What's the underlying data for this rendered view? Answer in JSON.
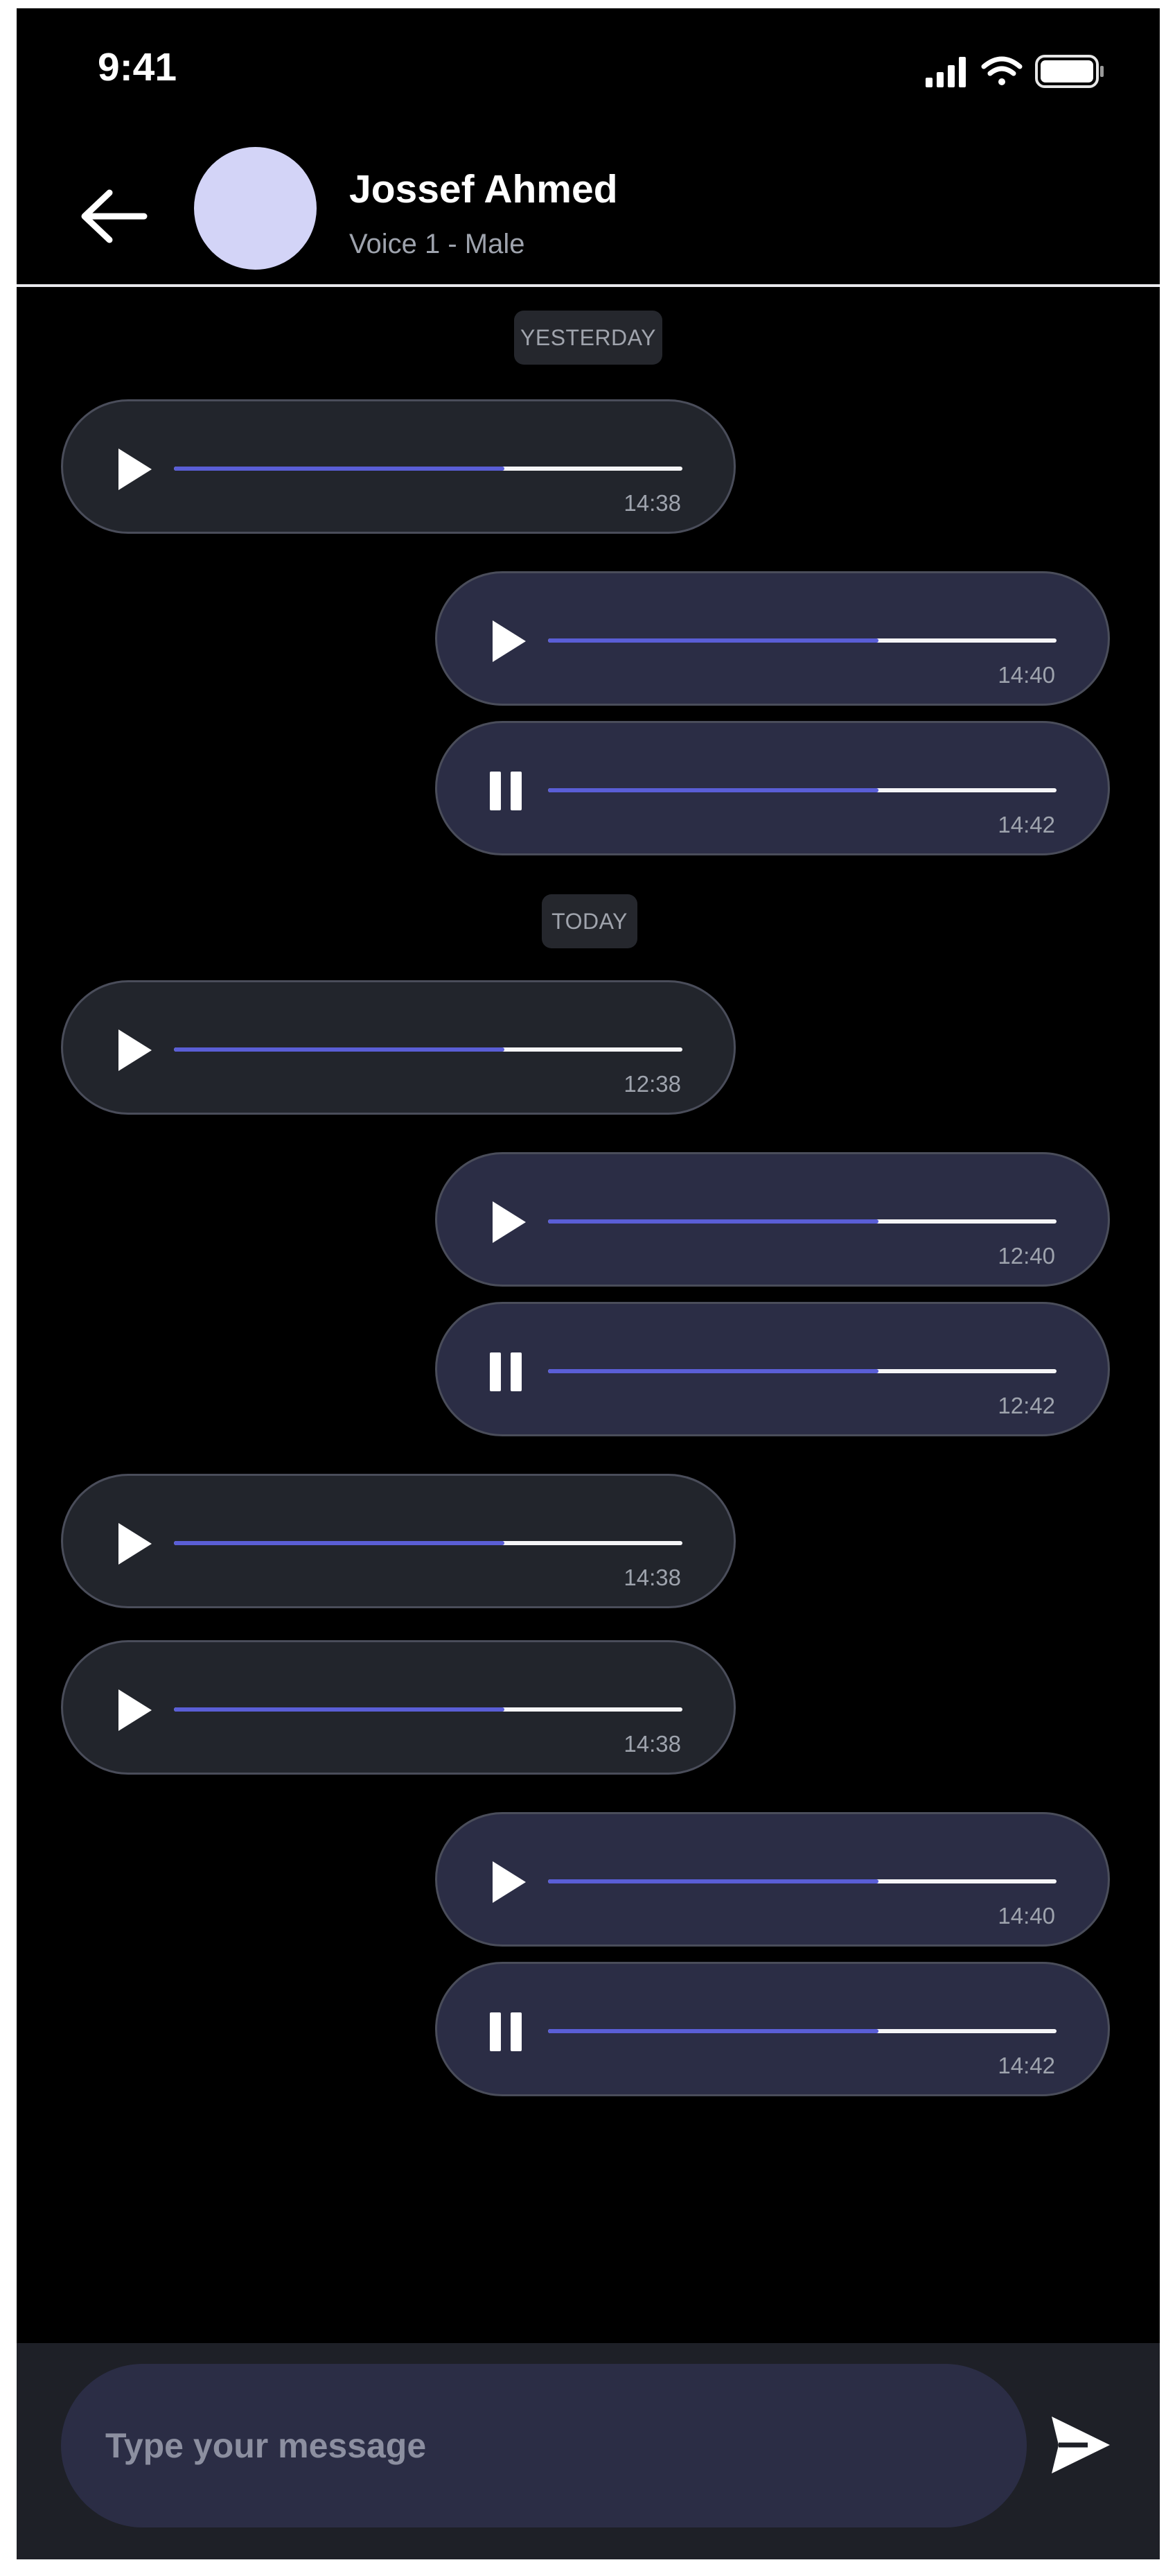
{
  "status_bar": {
    "time": "9:41"
  },
  "header": {
    "name": "Jossef Ahmed",
    "subtitle": "Voice 1 - Male"
  },
  "day_labels": [
    "YESTERDAY",
    "TODAY"
  ],
  "messages": [
    {
      "direction": "in",
      "state": "paused",
      "progress": 0.65,
      "time": "14:38"
    },
    {
      "direction": "out",
      "state": "paused",
      "progress": 0.65,
      "time": "14:40"
    },
    {
      "direction": "out",
      "state": "playing",
      "progress": 0.65,
      "time": "14:42"
    },
    {
      "direction": "in",
      "state": "paused",
      "progress": 0.65,
      "time": "12:38"
    },
    {
      "direction": "out",
      "state": "paused",
      "progress": 0.65,
      "time": "12:40"
    },
    {
      "direction": "out",
      "state": "playing",
      "progress": 0.65,
      "time": "12:42"
    },
    {
      "direction": "in",
      "state": "paused",
      "progress": 0.65,
      "time": "14:38"
    },
    {
      "direction": "in",
      "state": "paused",
      "progress": 0.65,
      "time": "14:38"
    },
    {
      "direction": "out",
      "state": "paused",
      "progress": 0.65,
      "time": "14:40"
    },
    {
      "direction": "out",
      "state": "playing",
      "progress": 0.65,
      "time": "14:42"
    }
  ],
  "composer": {
    "placeholder": "Type your message"
  },
  "icons": {
    "back": "arrow-left-icon",
    "play": "play-icon",
    "pause": "pause-icon",
    "send": "send-icon",
    "signal": "cellular-signal-icon",
    "wifi": "wifi-icon",
    "battery": "battery-icon"
  },
  "colors": {
    "background": "#000000",
    "incoming_bubble": "#22252c",
    "outgoing_bubble": "#2b2d45",
    "progress": "#5a5ed6",
    "avatar": "#d3d4f7"
  }
}
